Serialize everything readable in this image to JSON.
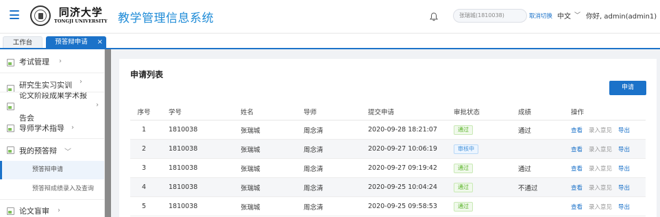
{
  "header": {
    "logo_cn": "同济大学",
    "logo_en": "TONGJI UNIVERSITY",
    "system_title": "教学管理信息系统",
    "user_search_value": "张瑞城(1810038)",
    "cancel_switch": "取消切换",
    "language": "中文",
    "greeting": "你好, admin(admin1)"
  },
  "tabs": {
    "home": "工作台",
    "active": "预答辩申请",
    "close": "×"
  },
  "sidebar": {
    "items": [
      {
        "label": "考试管理"
      },
      {
        "label": "研究生实习实训"
      },
      {
        "label": "论文阶段成果学术报"
      },
      {
        "label": "告会"
      },
      {
        "label": "导师学术指导"
      },
      {
        "label": "我的预答辩"
      },
      {
        "label": "论文盲审"
      }
    ],
    "sub_items": [
      {
        "label": "预答辩申请"
      },
      {
        "label": "预答辩成绩录入及查询"
      }
    ]
  },
  "main": {
    "title": "申请列表",
    "apply_button": "申请",
    "columns": [
      "序号",
      "学号",
      "姓名",
      "导师",
      "提交申请",
      "审批状态",
      "成绩",
      "操作"
    ],
    "rows": [
      {
        "idx": "1",
        "sid": "1810038",
        "name": "张瑞城",
        "tutor": "周念清",
        "time": "2020-09-28 18:21:07",
        "status": "通过",
        "status_type": "ok",
        "score": "通过"
      },
      {
        "idx": "2",
        "sid": "1810038",
        "name": "张瑞城",
        "tutor": "周念清",
        "time": "2020-09-27 10:06:19",
        "status": "审核中",
        "status_type": "review",
        "score": ""
      },
      {
        "idx": "3",
        "sid": "1810038",
        "name": "张瑞城",
        "tutor": "周念清",
        "time": "2020-09-27 09:19:42",
        "status": "通过",
        "status_type": "ok",
        "score": "通过"
      },
      {
        "idx": "4",
        "sid": "1810038",
        "name": "张瑞城",
        "tutor": "周念清",
        "time": "2020-09-25 10:04:24",
        "status": "通过",
        "status_type": "ok",
        "score": "不通过"
      },
      {
        "idx": "5",
        "sid": "1810038",
        "name": "张瑞城",
        "tutor": "周念清",
        "time": "2020-09-25 09:58:53",
        "status": "通过",
        "status_type": "ok",
        "score": ""
      }
    ],
    "ops": {
      "view": "查看",
      "opinion": "录入意见",
      "export": "导出"
    }
  },
  "colors": {
    "accent": "#1b72c9",
    "title": "#1e8bd7",
    "success": "#58b327"
  }
}
